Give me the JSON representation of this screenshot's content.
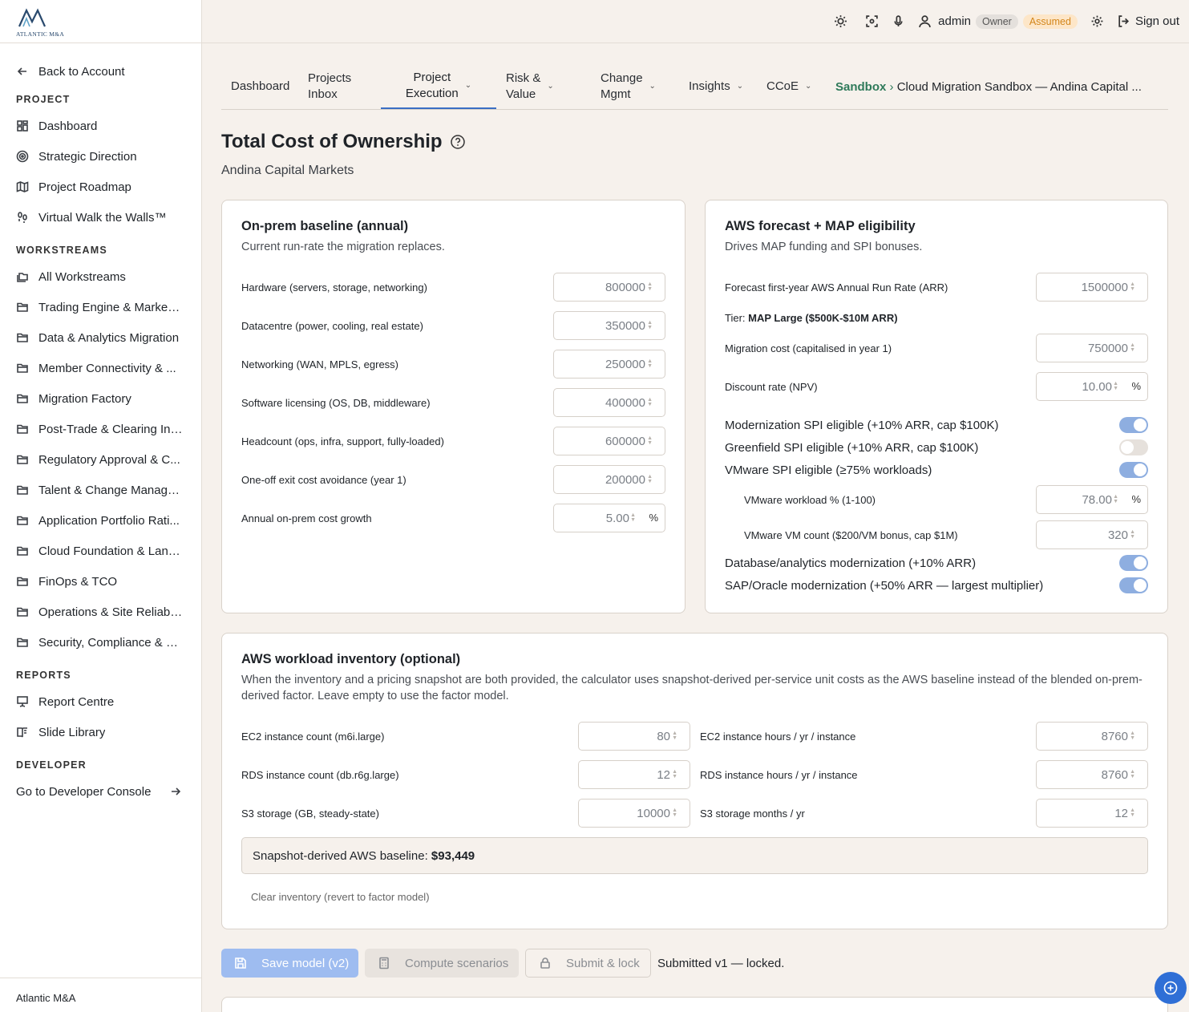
{
  "brand": {
    "logo_text": "ATLANTIC M&A",
    "footer": "Atlantic M&A"
  },
  "sidebar": {
    "back": "Back to Account",
    "sections": [
      {
        "title": "PROJECT",
        "items": [
          {
            "label": "Dashboard",
            "icon": "grid-icon"
          },
          {
            "label": "Strategic Direction",
            "icon": "target-icon"
          },
          {
            "label": "Project Roadmap",
            "icon": "map-icon"
          },
          {
            "label": "Virtual Walk the Walls™",
            "icon": "footprints-icon"
          }
        ]
      },
      {
        "title": "WORKSTREAMS",
        "items": [
          {
            "label": "All Workstreams",
            "icon": "folders-icon"
          },
          {
            "label": "Trading Engine & Market ...",
            "icon": "folder-icon"
          },
          {
            "label": "Data & Analytics Migration",
            "icon": "folder-icon"
          },
          {
            "label": "Member Connectivity & ...",
            "icon": "folder-icon"
          },
          {
            "label": "Migration Factory",
            "icon": "folder-icon"
          },
          {
            "label": "Post-Trade & Clearing Int...",
            "icon": "folder-icon"
          },
          {
            "label": "Regulatory Approval & C...",
            "icon": "folder-icon"
          },
          {
            "label": "Talent & Change Manage...",
            "icon": "folder-icon"
          },
          {
            "label": "Application Portfolio Rati...",
            "icon": "folder-icon"
          },
          {
            "label": "Cloud Foundation & Land...",
            "icon": "folder-icon"
          },
          {
            "label": "FinOps & TCO",
            "icon": "folder-icon"
          },
          {
            "label": "Operations & Site Reliabil...",
            "icon": "folder-icon"
          },
          {
            "label": "Security, Compliance & R...",
            "icon": "folder-icon"
          }
        ]
      },
      {
        "title": "REPORTS",
        "items": [
          {
            "label": "Report Centre",
            "icon": "presentation-icon"
          },
          {
            "label": "Slide Library",
            "icon": "book-icon"
          }
        ]
      },
      {
        "title": "DEVELOPER",
        "items": []
      }
    ],
    "dev_console": "Go to Developer Console"
  },
  "topbar": {
    "user": "admin",
    "owner_badge": "Owner",
    "assumed_badge": "Assumed",
    "signout": "Sign out"
  },
  "tabs": [
    {
      "label": "Dashboard",
      "dropdown": false
    },
    {
      "label": "Projects\nInbox",
      "dropdown": false
    },
    {
      "label": "Project\nExecution",
      "dropdown": true,
      "active": true
    },
    {
      "label": "Risk &\nValue",
      "dropdown": true
    },
    {
      "label": "Change\nMgmt",
      "dropdown": true
    },
    {
      "label": "Insights",
      "dropdown": true
    },
    {
      "label": "CCoE",
      "dropdown": true
    }
  ],
  "breadcrumb": {
    "sandbox": "Sandbox",
    "separator": " › ",
    "title": "Cloud Migration Sandbox — Andina Capital ..."
  },
  "page": {
    "title": "Total Cost of Ownership",
    "subtitle": "Andina Capital Markets"
  },
  "onprem": {
    "title": "On-prem baseline (annual)",
    "desc": "Current run-rate the migration replaces.",
    "fields": [
      {
        "label": "Hardware (servers, storage, networking)",
        "value": "800000"
      },
      {
        "label": "Datacentre (power, cooling, real estate)",
        "value": "350000"
      },
      {
        "label": "Networking (WAN, MPLS, egress)",
        "value": "250000"
      },
      {
        "label": "Software licensing (OS, DB, middleware)",
        "value": "400000"
      },
      {
        "label": "Headcount (ops, infra, support, fully-loaded)",
        "value": "600000"
      },
      {
        "label": "One-off exit cost avoidance (year 1)",
        "value": "200000"
      },
      {
        "label": "Annual on-prem cost growth",
        "value": "5.00",
        "unit": "%"
      }
    ]
  },
  "aws": {
    "title": "AWS forecast + MAP eligibility",
    "desc": "Drives MAP funding and SPI bonuses.",
    "arr_label": "Forecast first-year AWS Annual Run Rate (ARR)",
    "arr_value": "1500000",
    "tier_label": "Tier:",
    "tier_value": "MAP Large ($500K-$10M ARR)",
    "migration_label": "Migration cost (capitalised in year 1)",
    "migration_value": "750000",
    "discount_label": "Discount rate (NPV)",
    "discount_value": "10.00",
    "discount_unit": "%",
    "toggles": [
      {
        "label": "Modernization SPI eligible (+10% ARR, cap $100K)",
        "on": true
      },
      {
        "label": "Greenfield SPI eligible (+10% ARR, cap $100K)",
        "on": false
      },
      {
        "label": "VMware SPI eligible (≥75% workloads)",
        "on": true
      }
    ],
    "vmware_pct_label": "VMware workload % (1-100)",
    "vmware_pct_value": "78.00",
    "vmware_pct_unit": "%",
    "vmware_count_label": "VMware VM count ($200/VM bonus, cap $1M)",
    "vmware_count_value": "320",
    "toggles2": [
      {
        "label": "Database/analytics modernization (+10% ARR)",
        "on": true
      },
      {
        "label": "SAP/Oracle modernization (+50% ARR — largest multiplier)",
        "on": true
      }
    ]
  },
  "inventory": {
    "title": "AWS workload inventory (optional)",
    "desc": "When the inventory and a pricing snapshot are both provided, the calculator uses snapshot-derived per-service unit costs as the AWS baseline instead of the blended on-prem-derived factor. Leave empty to use the factor model.",
    "rows": [
      {
        "l1": "EC2 instance count (m6i.large)",
        "v1": "80",
        "l2": "EC2 instance hours / yr / instance",
        "v2": "8760"
      },
      {
        "l1": "RDS instance count (db.r6g.large)",
        "v1": "12",
        "l2": "RDS instance hours / yr / instance",
        "v2": "8760"
      },
      {
        "l1": "S3 storage (GB, steady-state)",
        "v1": "10000",
        "l2": "S3 storage months / yr",
        "v2": "12"
      }
    ],
    "baseline_label": "Snapshot-derived AWS baseline:",
    "baseline_value": "$93,449",
    "clear": "Clear inventory (revert to factor model)"
  },
  "actions": {
    "save": "Save model (v2)",
    "compute": "Compute scenarios",
    "submit": "Submit & lock",
    "status": "Submitted v1 — locked."
  },
  "colors": {
    "accent": "#3b6fc4",
    "sandbox": "#2f7a5a",
    "assumed": "#d3861b",
    "toggle_on": "#8eaee0",
    "save_btn": "#9ebcf0"
  }
}
